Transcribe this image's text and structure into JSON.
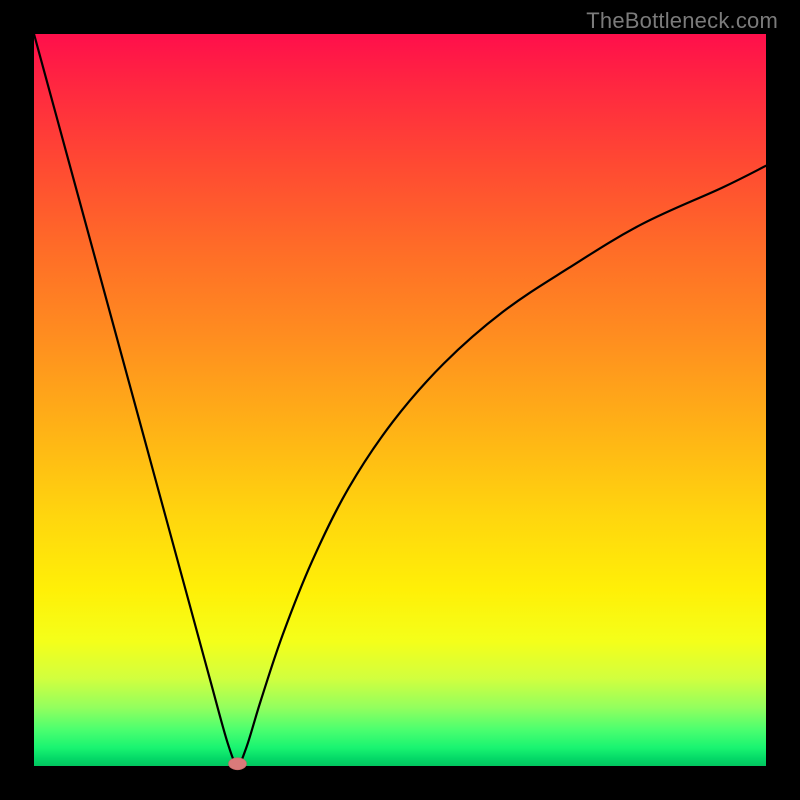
{
  "watermark": "TheBottleneck.com",
  "chart_data": {
    "type": "line",
    "title": "",
    "xlabel": "",
    "ylabel": "",
    "xlim": [
      0,
      100
    ],
    "ylim": [
      0,
      100
    ],
    "grid": false,
    "legend": false,
    "background": "red-to-green vertical gradient (bottleneck heatmap)",
    "series": [
      {
        "name": "bottleneck-curve",
        "x": [
          0,
          3,
          6,
          9,
          12,
          15,
          18,
          21,
          24,
          26.5,
          27.8,
          29,
          31,
          34,
          38,
          43,
          49,
          56,
          64,
          73,
          83,
          94,
          100
        ],
        "values": [
          100,
          89,
          78,
          67,
          56,
          45,
          34,
          23,
          12,
          3,
          0.3,
          2.5,
          9,
          18,
          28,
          38,
          47,
          55,
          62,
          68,
          74,
          79,
          82
        ]
      }
    ],
    "marker": {
      "x": 27.8,
      "y": 0.3,
      "shape": "ellipse",
      "color": "#d97a7a"
    }
  }
}
